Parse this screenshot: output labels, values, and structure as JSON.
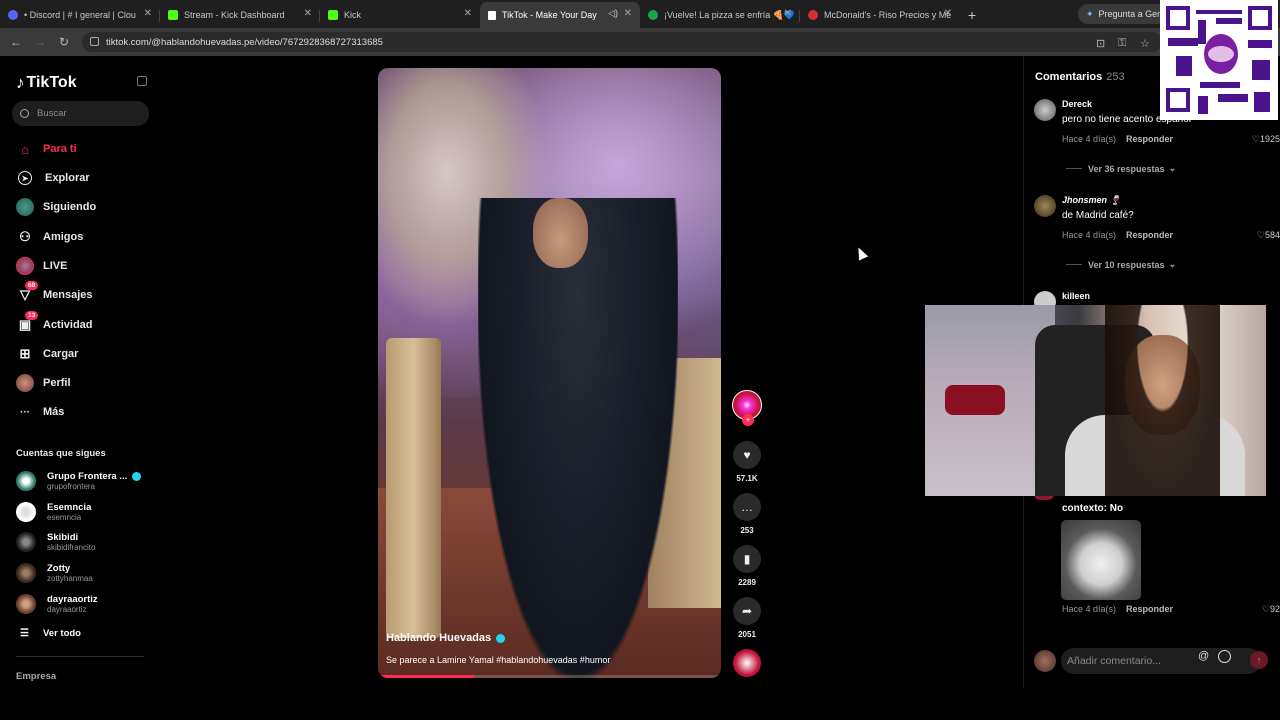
{
  "browser": {
    "tabs": [
      {
        "label": "• Discord | #  I general | Clou",
        "color": "#5865f2",
        "active": false
      },
      {
        "label": "Stream - Kick Dashboard",
        "color": "#53fc18",
        "active": false
      },
      {
        "label": "Kick",
        "color": "#53fc18",
        "active": false
      },
      {
        "label": "TikTok - Make Your Day",
        "color": "#ffffff",
        "active": true
      },
      {
        "label": "¡Vuelve! La pizza se enfría 🍕💙",
        "color": "#1aa34a",
        "active": false
      },
      {
        "label": "McDonald's - Riso Precios y Me",
        "color": "#d32f2f",
        "active": false
      }
    ],
    "gemini_label": "Pregunta a Gemi",
    "url": "tiktok.com/@hablandohuevadas.pe/video/7672928368727313685"
  },
  "sidebar": {
    "brand": "TikTok",
    "search_placeholder": "Buscar",
    "nav": [
      {
        "label": "Para ti",
        "icon": "home-icon",
        "glyph": "⌂",
        "active": true,
        "badge": ""
      },
      {
        "label": "Explorar",
        "icon": "compass-icon",
        "glyph": "◎",
        "active": false,
        "badge": ""
      },
      {
        "label": "Siguiendo",
        "icon": "following-avatar-icon",
        "glyph": "●",
        "active": false,
        "badge": ""
      },
      {
        "label": "Amigos",
        "icon": "friends-icon",
        "glyph": "⚇",
        "active": false,
        "badge": ""
      },
      {
        "label": "LIVE",
        "icon": "live-icon",
        "glyph": "◉",
        "active": false,
        "badge": ""
      },
      {
        "label": "Mensajes",
        "icon": "messages-icon",
        "glyph": "▽",
        "active": false,
        "badge": "68"
      },
      {
        "label": "Actividad",
        "icon": "activity-icon",
        "glyph": "▣",
        "active": false,
        "badge": "13"
      },
      {
        "label": "Cargar",
        "icon": "upload-icon",
        "glyph": "⊞",
        "active": false,
        "badge": ""
      },
      {
        "label": "Perfil",
        "icon": "profile-icon",
        "glyph": "●",
        "active": false,
        "badge": ""
      },
      {
        "label": "Más",
        "icon": "more-icon",
        "glyph": "···",
        "active": false,
        "badge": ""
      }
    ],
    "following_title": "Cuentas que sigues",
    "accounts": [
      {
        "name": "Grupo Frontera ...",
        "handle": "grupofrontera",
        "verified": true,
        "color": "#2e7d6b"
      },
      {
        "name": "Esemncia",
        "handle": "esemncia",
        "verified": false,
        "color": "#eeeeee"
      },
      {
        "name": "Skibidi",
        "handle": "skibidifrancito",
        "verified": false,
        "color": "#444444"
      },
      {
        "name": "Zotty",
        "handle": "zottyhanmaa",
        "verified": false,
        "color": "#6a5040"
      },
      {
        "name": "dayraaortiz",
        "handle": "dayraaortiz",
        "verified": false,
        "color": "#a07050"
      }
    ],
    "see_all": "Ver todo",
    "footer": "Empresa"
  },
  "video": {
    "author": "Hablando Huevadas",
    "description": "Se parece a Lamine Yamal #hablandohuevadas #humor",
    "progress": 0.28
  },
  "actions": {
    "likes": "57.1K",
    "comments": "253",
    "saves": "2289",
    "shares": "2051"
  },
  "comments": {
    "title": "Comentarios",
    "count": "253",
    "items": [
      {
        "user": "Dereck",
        "text": "pero no tiene acento español",
        "time": "Hace 4 día(s)",
        "reply": "Responder",
        "likes": "1925",
        "color": "#777777"
      },
      {
        "user": "Jhonsmen 🍷",
        "text": "de Madrid café?",
        "time": "Hace 4 día(s)",
        "reply": "Responder",
        "likes": "584",
        "color": "#6a5a3a"
      },
      {
        "user": "killeen",
        "text": "",
        "time": "",
        "reply": "",
        "likes": "",
        "color": "#cccccc"
      },
      {
        "user": "",
        "text": "contexto: No",
        "time": "Hace 4 día(s)",
        "reply": "Responder",
        "likes": "92",
        "color": "#8a1a2a"
      }
    ],
    "replies": [
      "Ver 36 respuestas",
      "Ver 10 respuestas"
    ],
    "input_placeholder": "Añadir comentario..."
  }
}
